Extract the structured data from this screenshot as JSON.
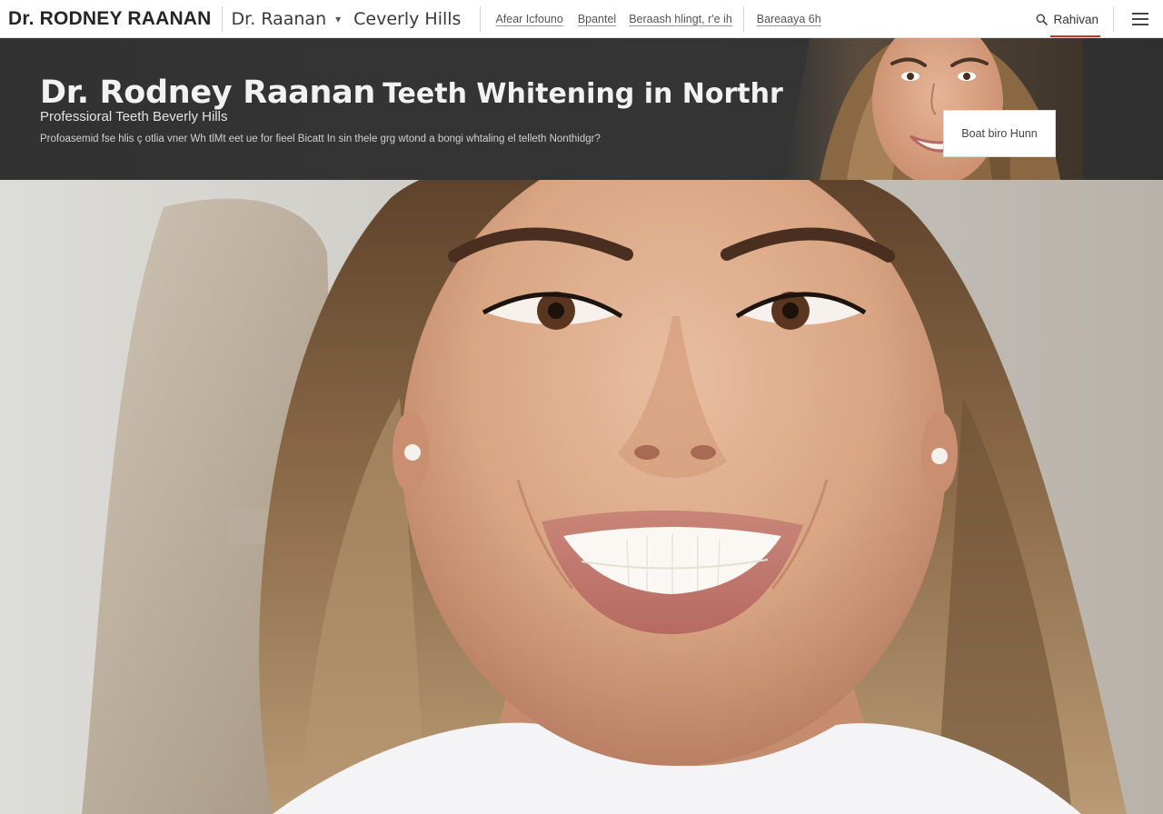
{
  "header": {
    "brand": "Dr. RODNEY RAANAN",
    "doctor_name": "Dr. Raanan",
    "location": "Ceverly Hills",
    "nav_links": [
      "Afear Icfouno",
      "Bpantel",
      "Beraash hlingt, r'e ih",
      "Bareaaya 6h"
    ],
    "search_label": "Rahivan",
    "icons": {
      "dropdown": "chevron-down-icon",
      "search": "search-icon",
      "menu": "hamburger-menu-icon"
    }
  },
  "banner": {
    "title_name": "Dr. Rodney Raanan",
    "title_service": "Teeth Whitening in Northridge",
    "subtitle": "Professioral Teeth Beverly Hills",
    "description": "Profoasemid fse hlis ç otlia  vner  Wh tlMt eet ue for fieel Bicatt  In sin thele grg  wtond a bongi  whtaling el telleth Nonthidgr?",
    "cta_label": "Boat biro Hunn"
  },
  "colors": {
    "banner_bg": "#343434",
    "accent": "#c0392b",
    "header_bg": "#ffffff"
  }
}
